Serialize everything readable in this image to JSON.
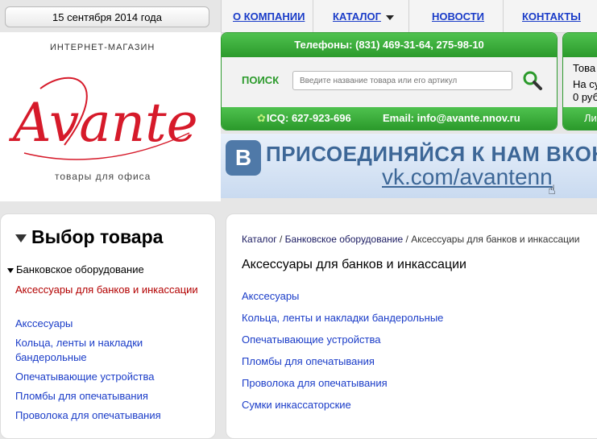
{
  "header": {
    "date": "15 сентября 2014 года",
    "nav": [
      "О КОМПАНИИ",
      "КАТАЛОГ",
      "НОВОСТИ",
      "КОНТАКТЫ"
    ]
  },
  "logo": {
    "top": "ИНТЕРНЕТ-МАГАЗИН",
    "script": "Avante",
    "bottom": "товары для офиса"
  },
  "contacts": {
    "phones": "Телефоны: (831) 469-31-64, 275-98-10",
    "search_label": "ПОИСК",
    "search_placeholder": "Введите название товара или его артикул",
    "icq": "ICQ: 627-923-696",
    "email_label": "Email:",
    "email": "info@avante.nnov.ru"
  },
  "cart": {
    "line1": "Това",
    "line2": "На су",
    "line3": "0 руб",
    "bottom": "Ли"
  },
  "vk_banner": {
    "line1": "ПРИСОЕДИНЯЙСЯ К НАМ ВКОН",
    "line2": "vk.com/avantenn"
  },
  "sidebar": {
    "title": "Выбор товара",
    "category": "Банковское оборудование",
    "items": [
      "Аксессуары для банков и инкассации",
      "Акссесуары",
      "Кольца, ленты и накладки бандерольные",
      "Опечатывающие устройства",
      "Пломбы для опечатывания",
      "Проволока для опечатывания"
    ]
  },
  "main": {
    "breadcrumb": [
      "Каталог",
      "Банковское оборудование",
      "Аксессуары для банков и инкассации"
    ],
    "breadcrumb_sep": "/",
    "title": "Аксессуары для банков и инкассации",
    "links": [
      "Акссесуары",
      "Кольца, ленты и накладки бандерольные",
      "Опечатывающие устройства",
      "Пломбы для опечатывания",
      "Проволока для опечатывания",
      "Сумки инкассаторские"
    ]
  },
  "colors": {
    "green": "#2b9a2b",
    "link": "#1a3cc8",
    "active": "#b30000",
    "logo": "#d61a2a"
  }
}
